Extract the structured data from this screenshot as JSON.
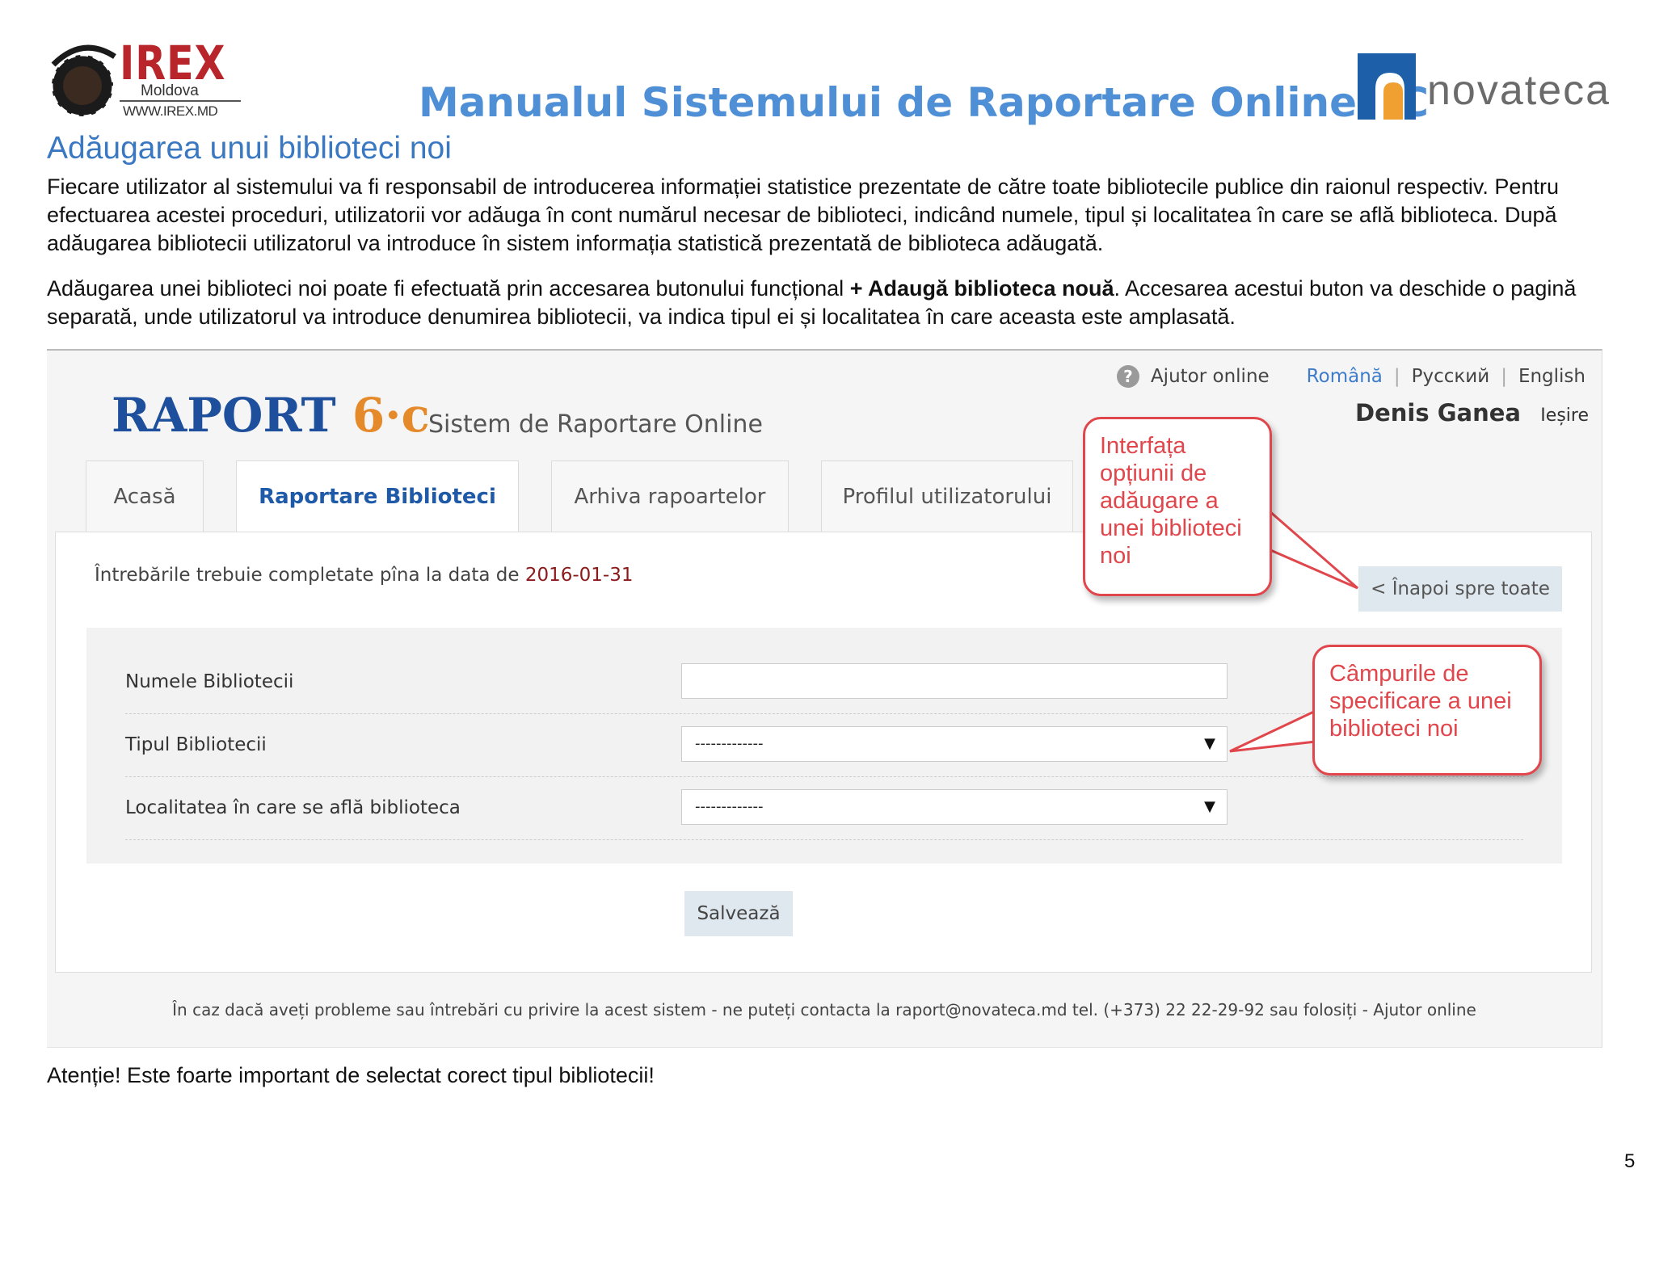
{
  "header": {
    "irex_logo": {
      "name": "IREX",
      "country": "Moldova",
      "url": "WWW.IREX.MD"
    },
    "manual_title": "Manualul Sistemului de Raportare Online 6C",
    "novateca_logo": {
      "name": "novateca"
    }
  },
  "section_title": "Adăugarea unui biblioteci noi",
  "paragraphs": [
    "Fiecare utilizator al sistemului va fi responsabil de introducerea informației statistice prezentate de către toate bibliotecile publice din raionul respectiv. Pentru efectuarea acestei proceduri, utilizatorii vor adăuga în cont numărul necesar de biblioteci, indicând numele, tipul și localitatea în care se află biblioteca. După adăugarea bibliotecii utilizatorul va introduce în sistem informația statistică prezentată de biblioteca adăugată.",
    {
      "before": "Adăugarea unei biblioteci noi poate fi efectuată prin accesarea butonului funcțional ",
      "bold": "+ Adaugă biblioteca nouă",
      "after": ". Accesarea acestui buton va deschide o pagină separată, unde utilizatorul va introduce denumirea bibliotecii, va indica tipul ei și localitatea în care aceasta este amplasată."
    }
  ],
  "screenshot": {
    "topnav": {
      "help_icon": "question-icon",
      "help": "Ajutor online",
      "languages": [
        "Română",
        "Русский",
        "English"
      ],
      "active_language": "Română"
    },
    "brand": {
      "raport": "RAPORT",
      "suffix": "6·c"
    },
    "subtitle": "Sistem de Raportare Online",
    "user_name": "Denis Ganea",
    "logout": "Ieșire",
    "tabs": [
      "Acasă",
      "Raportare Biblioteci",
      "Arhiva rapoartelor",
      "Profilul utilizatorului"
    ],
    "active_tab": "Raportare Biblioteci",
    "deadline_text": "Întrebările trebuie completate pîna la data de ",
    "deadline_date": "2016-01-31",
    "back_button": "< Înapoi spre toate",
    "form": {
      "name_label": "Numele Bibliotecii",
      "name_value": "",
      "type_label": "Tipul Bibliotecii",
      "type_value": "-------------",
      "locality_label": "Localitatea în care se află biblioteca",
      "locality_value": "-------------"
    },
    "save_button": "Salvează",
    "footer": "În caz dacă aveți probleme sau întrebări cu privire la acest sistem - ne puteți contacta la raport@novateca.md tel. (+373) 22 22-29-92 sau folosiți - Ajutor online"
  },
  "callouts": {
    "interface": "Interfața opțiunii de adăugare a unei biblioteci noi",
    "fields": "Câmpurile de specificare a unei biblioteci noi"
  },
  "note": "Atenție! Este foarte important de selectat corect tipul bibliotecii!",
  "page_number": "5",
  "colors": {
    "title_blue": "#4f8fd6",
    "brand_blue": "#1e4f9c",
    "brand_orange": "#e58a2a",
    "irex_red": "#b8262c",
    "callout_red": "#e0464b",
    "deadline_red": "#8b1a1a"
  }
}
